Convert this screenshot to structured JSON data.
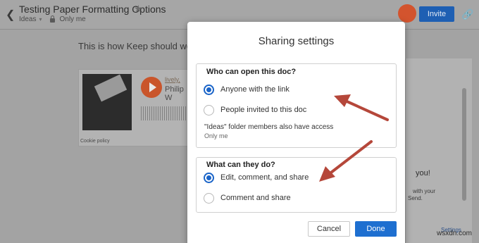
{
  "header": {
    "title": "Testing Paper Formatting Options",
    "folder": "Ideas",
    "visibility": "Only me",
    "invite_label": "Invite"
  },
  "document": {
    "body_text": "This is how Keep should work",
    "card": {
      "by_label": "lively,",
      "artist": "Philip W",
      "cookie_label": "Cookie policy"
    }
  },
  "right_panel": {
    "heading": "you!",
    "line1": "with your",
    "line2": "Send.",
    "link": "Settings"
  },
  "dialog": {
    "title": "Sharing settings",
    "section_open": {
      "legend": "Who can open this doc?",
      "options": [
        {
          "label": "Anyone with the link",
          "selected": true
        },
        {
          "label": "People invited to this doc",
          "selected": false
        }
      ],
      "note": "\"Ideas\" folder members also have access",
      "note_sub": "Only me"
    },
    "section_do": {
      "legend": "What can they do?",
      "options": [
        {
          "label": "Edit, comment, and share",
          "selected": true
        },
        {
          "label": "Comment and share",
          "selected": false
        }
      ]
    },
    "cancel_label": "Cancel",
    "done_label": "Done"
  },
  "colors": {
    "accent": "#1e6fd0",
    "arrow": "#b5473a",
    "avatar": "#d3542e"
  },
  "watermark": "wsxdn.com"
}
